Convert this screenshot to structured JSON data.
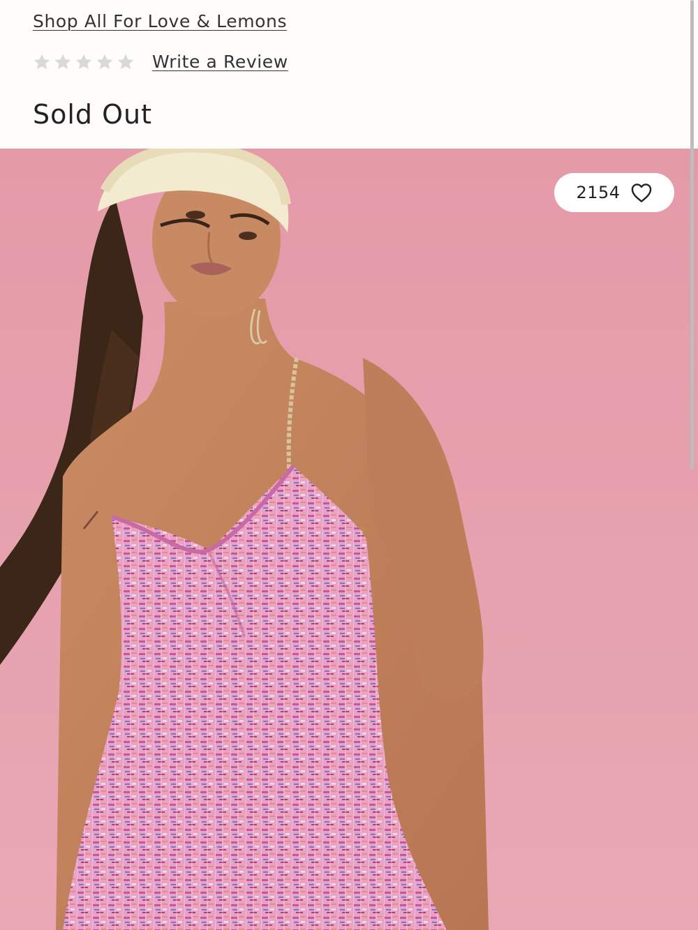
{
  "header": {
    "brand_link": "Shop All For Love & Lemons",
    "rating": {
      "stars_filled": 0,
      "stars_total": 5,
      "star_color": "#d9d9d9"
    },
    "write_review": "Write a Review",
    "availability": "Sold Out"
  },
  "product_image": {
    "background_color": "#e59aa8",
    "favorite_count": "2154",
    "favorite_icon": "heart-outline-icon"
  }
}
